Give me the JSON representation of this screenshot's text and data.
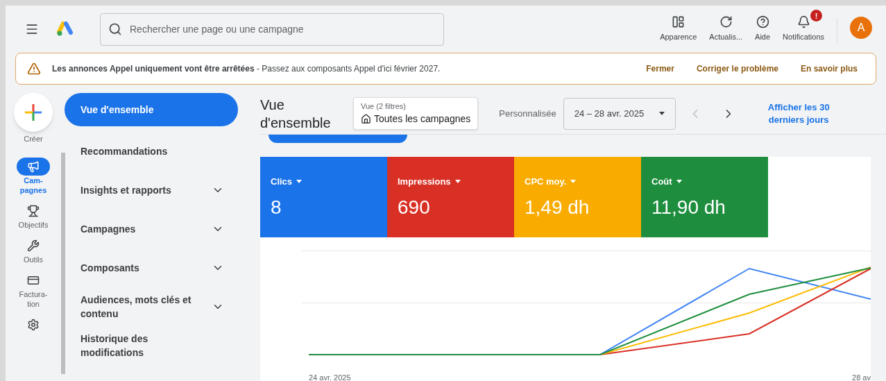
{
  "header": {
    "search": {
      "placeholder": "Rechercher une page ou une campagne"
    },
    "actions": [
      {
        "kind": "appearance",
        "label": "Apparence"
      },
      {
        "kind": "refresh",
        "label": "Actualis..."
      },
      {
        "kind": "help",
        "label": "Aide"
      },
      {
        "kind": "notifications",
        "label": "Notifications",
        "badge": "!"
      }
    ],
    "avatar": "A"
  },
  "banner": {
    "message": "**Les annonces Appel uniquement vont être arrêtées** - Passez aux composants Appel d'ici février 2027.",
    "actions": [
      "Fermer",
      "Corriger le problème",
      "En savoir plus"
    ]
  },
  "rail": {
    "create": "Créer",
    "items": [
      {
        "kind": "campaigns",
        "lines": [
          "Cam-",
          "pagnes"
        ],
        "selected": true
      },
      {
        "kind": "goals",
        "lines": [
          "Objectifs"
        ],
        "selected": false
      },
      {
        "kind": "tools",
        "lines": [
          "Outils"
        ],
        "selected": false
      },
      {
        "kind": "billing",
        "lines": [
          "Factura-",
          "tion"
        ],
        "selected": false
      },
      {
        "kind": "admin",
        "selected": false
      }
    ]
  },
  "nav": {
    "items": [
      {
        "label": "Vue d'ensemble",
        "selected": true,
        "expandable": false
      },
      {
        "label": "Recommandations",
        "selected": false,
        "expandable": false
      },
      {
        "label": "Insights et rapports",
        "selected": false,
        "expandable": true
      },
      {
        "label": "Campagnes",
        "selected": false,
        "expandable": true
      },
      {
        "label": "Composants",
        "selected": false,
        "expandable": true
      },
      {
        "label": "Audiences, mots clés et contenu",
        "selected": false,
        "expandable": true
      },
      {
        "label": "Historique des modifications",
        "selected": false,
        "expandable": false
      }
    ]
  },
  "main": {
    "title": "Vue d'ensemble",
    "filter": {
      "caption": "Vue (2 filtres)",
      "value": "Toutes les campagnes"
    },
    "date_preset": "Personnalisée",
    "date_range": "24 – 28 avr. 2025",
    "range_link": "Afficher les 30 derniers jours",
    "metrics": [
      {
        "label": "Clics",
        "value": "8",
        "color": "#1a73e8"
      },
      {
        "label": "Impressions",
        "value": "690",
        "color": "#d93025"
      },
      {
        "label": "CPC moy.",
        "value": "1,49 dh",
        "color": "#f9ab00"
      },
      {
        "label": "Coût",
        "value": "11,90 dh",
        "color": "#1e8e3e"
      }
    ],
    "chart": {
      "x_start": "24 avr. 2025",
      "x_end": "28 av"
    }
  }
}
